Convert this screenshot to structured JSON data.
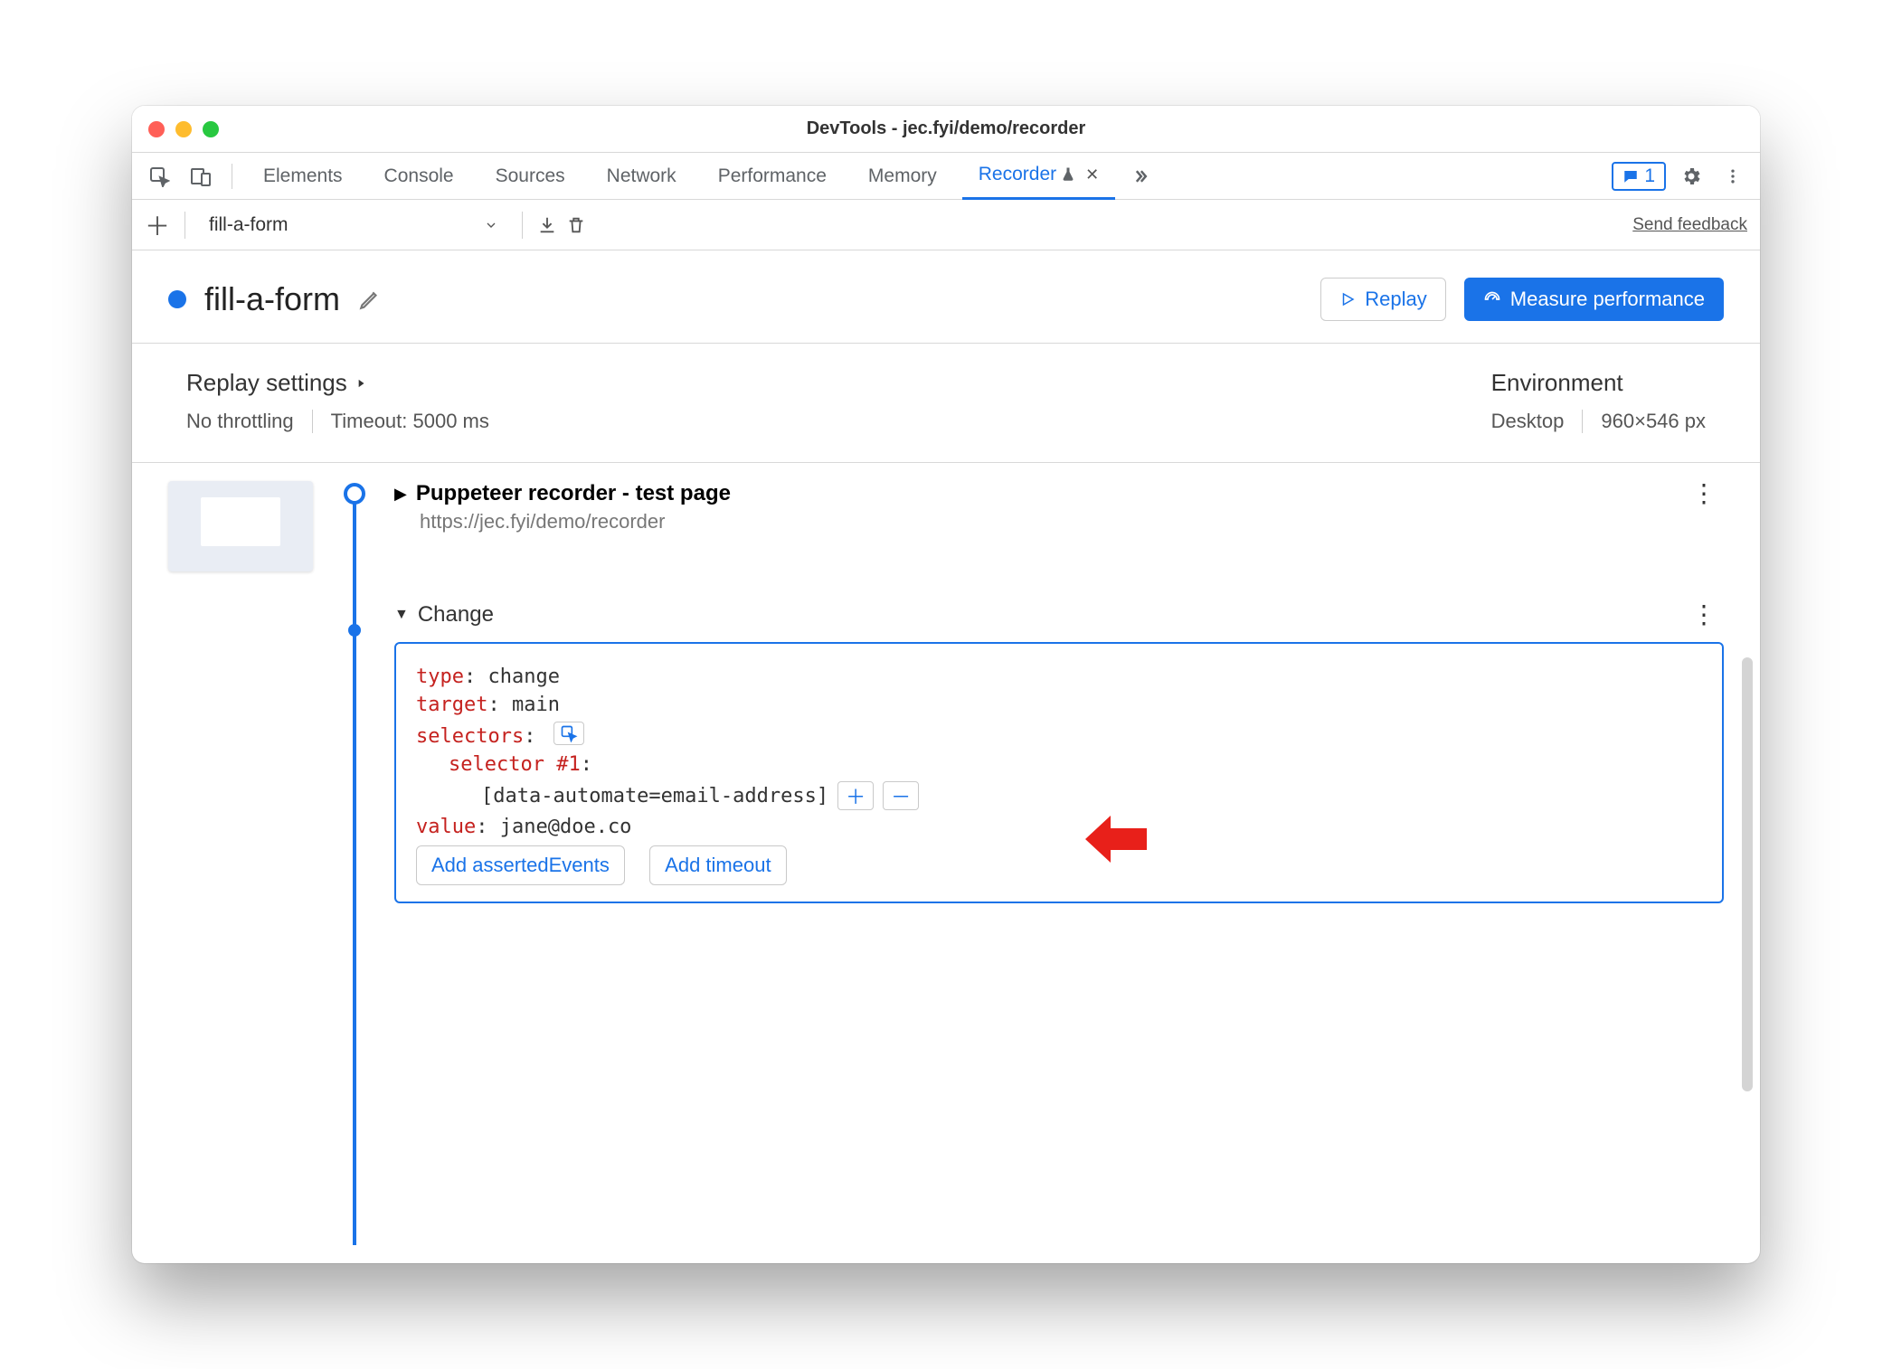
{
  "window": {
    "title": "DevTools - jec.fyi/demo/recorder"
  },
  "tabs": {
    "elements": "Elements",
    "console": "Console",
    "sources": "Sources",
    "network": "Network",
    "performance": "Performance",
    "memory": "Memory",
    "recorder": "Recorder"
  },
  "issues_count": "1",
  "recorder_toolbar": {
    "recording_name": "fill-a-form",
    "send_feedback": "Send feedback"
  },
  "main": {
    "title": "fill-a-form",
    "replay_label": "Replay",
    "measure_label": "Measure performance"
  },
  "settings": {
    "replay_heading": "Replay settings",
    "throttle": "No throttling",
    "timeout": "Timeout: 5000 ms",
    "env_heading": "Environment",
    "device": "Desktop",
    "viewport": "960×546 px"
  },
  "steps": {
    "step1": {
      "title": "Puppeteer recorder - test page",
      "url": "https://jec.fyi/demo/recorder"
    },
    "step2": {
      "label": "Change",
      "props": {
        "type_key": "type",
        "type_val": "change",
        "target_key": "target",
        "target_val": "main",
        "selectors_key": "selectors",
        "selector_label": "selector #1",
        "selector_val": "[data-automate=email-address]",
        "value_key": "value",
        "value_val": "jane@doe.co"
      },
      "add_asserted": "Add assertedEvents",
      "add_timeout": "Add timeout"
    }
  }
}
